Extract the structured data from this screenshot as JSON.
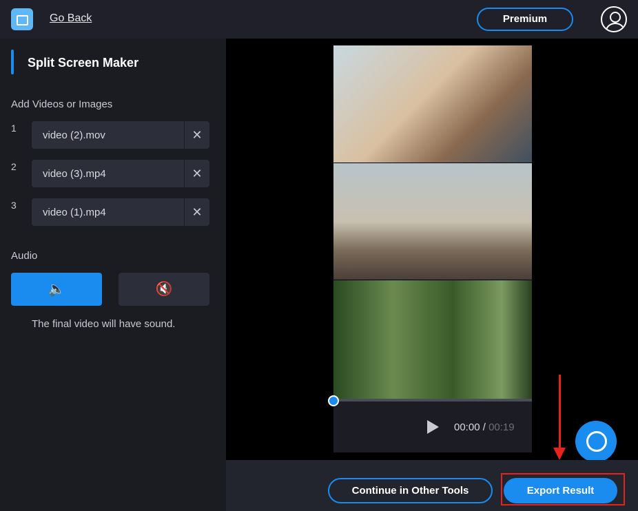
{
  "header": {
    "go_back": "Go Back",
    "premium": "Premium"
  },
  "sidebar": {
    "title": "Split Screen Maker",
    "add_label": "Add Videos or Images",
    "files": [
      {
        "index": "1",
        "name": "video (2).mov"
      },
      {
        "index": "2",
        "name": "video (3).mp4"
      },
      {
        "index": "3",
        "name": "video (1).mp4"
      }
    ],
    "remove_icon": "✕",
    "audio_label": "Audio",
    "sound_on_icon": "🔈",
    "sound_off_icon": "🔇",
    "audio_note": "The final video will have sound."
  },
  "player": {
    "current_time": "00:00",
    "separator": " / ",
    "duration": "00:19",
    "progress": 0
  },
  "footer": {
    "continue": "Continue in Other Tools",
    "export": "Export Result"
  },
  "colors": {
    "accent": "#1a8cf0",
    "highlight": "#e8221c"
  }
}
